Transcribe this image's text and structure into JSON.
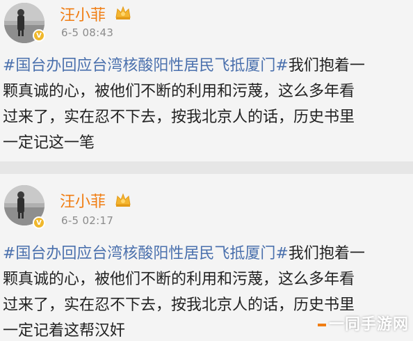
{
  "colors": {
    "username": "#f07d12",
    "hashtag": "#4a70ad",
    "timestamp": "#8b8b8b",
    "text": "#222222"
  },
  "posts": [
    {
      "username": "汪小菲",
      "timestamp": "6-5 08:43",
      "hashtag": "#国台办回应台湾核酸阳性居民飞抵厦门#",
      "lines": [
        "我们抱着一",
        "颗真诚的心，被他们不断的利用和污蔑，这么多年看",
        "过来了，实在忍不下去，按我北京人的话，历史书里",
        "一定记这一笔"
      ]
    },
    {
      "username": "汪小菲",
      "timestamp": "6-5 02:17",
      "hashtag": "#国台办回应台湾核酸阳性居民飞抵厦门#",
      "lines": [
        "我们抱着一",
        "颗真诚的心，被他们不断的利用和污蔑，这么多年看",
        "过来了，实在忍不下去，按我北京人的话，历史书里",
        "一定记着这帮汉奸"
      ]
    }
  ],
  "watermark": "一同手游网"
}
